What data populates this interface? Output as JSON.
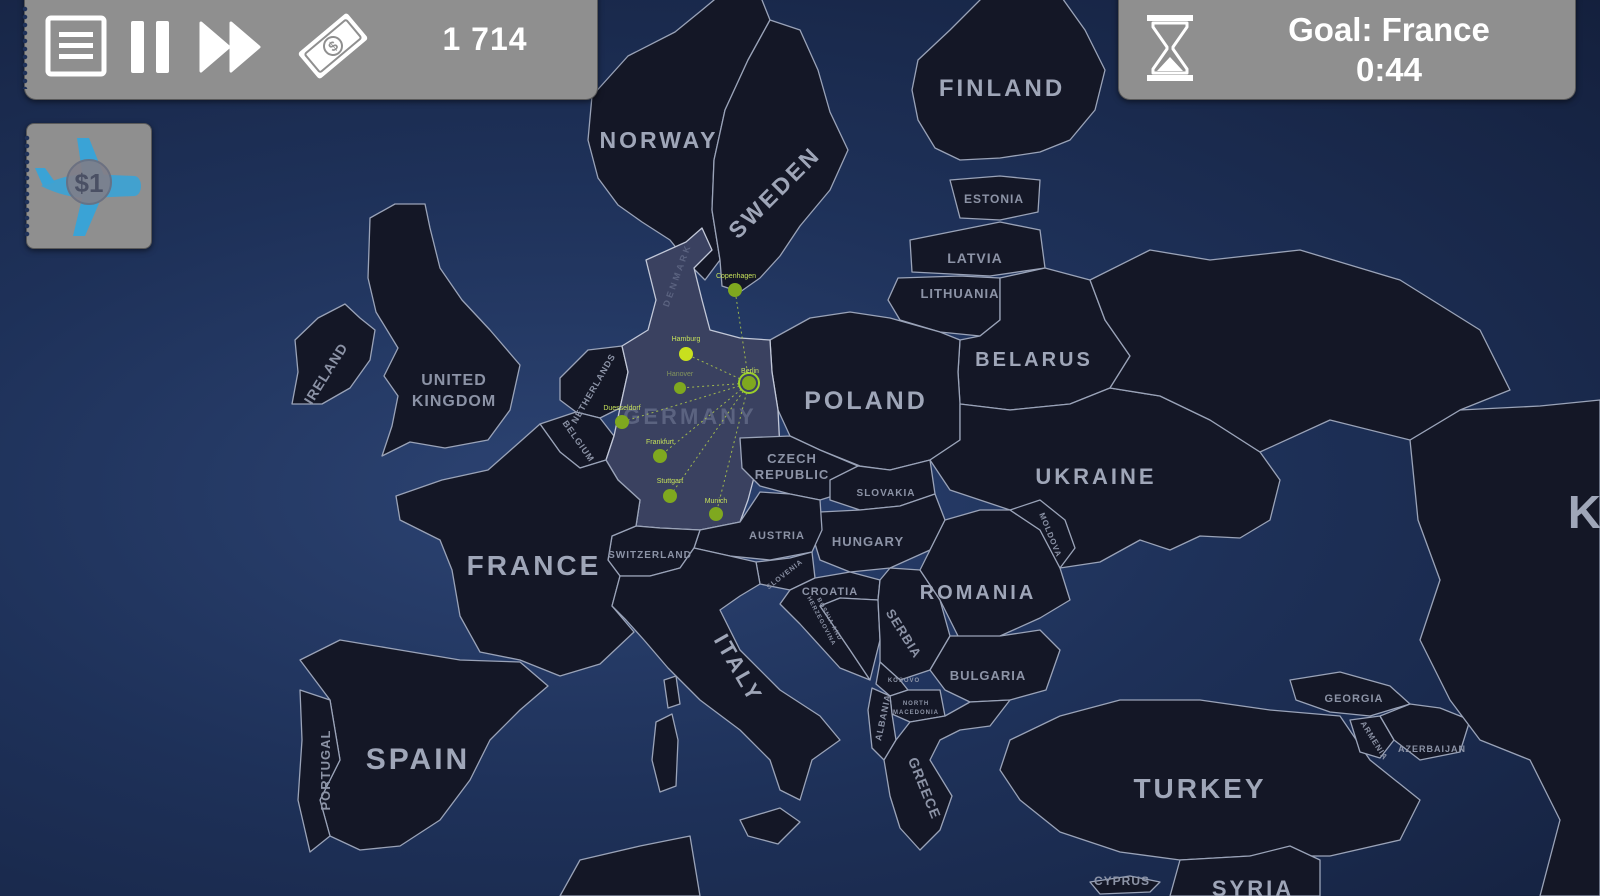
{
  "hud": {
    "money": "1 714",
    "goal_text": "Goal: France",
    "timer": "0:44",
    "plane_card_price": "$1",
    "icons": {
      "menu": "menu-icon",
      "pause": "pause-icon",
      "fast_forward": "fast-forward-icon",
      "cash": "cash-icon",
      "hourglass": "hourglass-icon",
      "plane": "plane-icon"
    }
  },
  "countries": {
    "norway": "NORWAY",
    "sweden": "SWEDEN",
    "finland": "FINLAND",
    "estonia": "ESTONIA",
    "latvia": "LATVIA",
    "lithuania": "LITHUANIA",
    "belarus": "BELARUS",
    "poland": "POLAND",
    "ukraine": "UKRAINE",
    "ireland": "IRELAND",
    "uk_line1": "UNITED",
    "uk_line2": "KINGDOM",
    "netherlands": "NETHERLANDS",
    "belgium": "BELGIUM",
    "denmark": "DENMARK",
    "germany": "GERMANY",
    "czech_line1": "CZECH",
    "czech_line2": "REPUBLIC",
    "slovakia": "SLOVAKIA",
    "hungary": "HUNGARY",
    "austria": "AUSTRIA",
    "switzerland": "SWITZERLAND",
    "france": "FRANCE",
    "slovenia": "SLOVENIA",
    "croatia": "CROATIA",
    "bosnia_line1": "BOSNIA AND",
    "bosnia_line2": "HERZEGOVINA",
    "serbia": "SERBIA",
    "romania": "ROMANIA",
    "moldova": "MOLDOVA",
    "kosovo": "KOSOVO",
    "north_mac_line1": "NORTH",
    "north_mac_line2": "MACEDONIA",
    "albania": "ALBANIA",
    "bulgaria": "BULGARIA",
    "greece": "GREECE",
    "italy": "ITALY",
    "spain": "SPAIN",
    "portugal": "PORTUGAL",
    "turkey": "TURKEY",
    "georgia": "GEORGIA",
    "armenia": "ARMENIA",
    "azerbaijan": "AZERBAIJAN",
    "cyprus": "CYPRUS",
    "syria": "SYRIA",
    "kazakhstan_partial": "K"
  },
  "cities": {
    "copenhagen": "Copenhagen",
    "hamburg": "Hamburg",
    "berlin": "Berlin",
    "hanover": "Hanover",
    "dusseldorf": "Duesseldorf",
    "frankfurt": "Frankfurt",
    "stuttgart": "Stuttgart",
    "munich": "Munich"
  }
}
